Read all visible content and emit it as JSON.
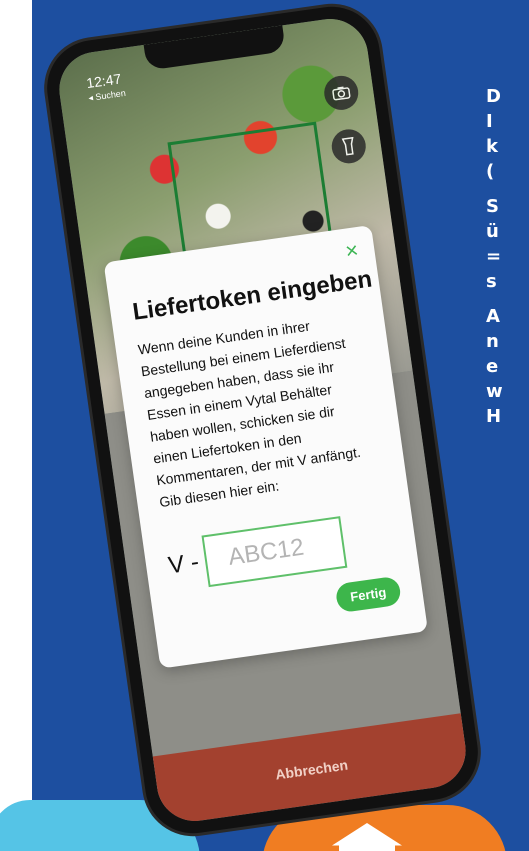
{
  "side_text": {
    "lines_block1": [
      "D",
      "I",
      "k",
      "("
    ],
    "lines_block2": [
      "S",
      "ü",
      "=",
      "s"
    ],
    "lines_block3": [
      "A",
      "n",
      "e",
      "w",
      "H"
    ]
  },
  "phone": {
    "status_time": "12:47",
    "status_back": "◂ Suchen",
    "camera_icon": "camera-icon",
    "flashlight_icon": "flashlight-icon",
    "cancel_label": "Abbrechen"
  },
  "dialog": {
    "close_glyph": "×",
    "title": "Liefertoken eingeben",
    "text": "Wenn deine Kunden in ihrer Bestellung bei einem Lieferdienst angegeben haben, dass sie ihr Essen in einem Vytal Behälter haben wollen, schicken sie dir einen Liefertoken in den Kommentaren, der mit V anfängt. Gib diesen hier ein:",
    "token_prefix": "V -",
    "token_placeholder": "ABC12",
    "token_value": "",
    "done_label": "Fertig"
  },
  "colors": {
    "panel_blue": "#1d4fa0",
    "accent_green": "#3db64b",
    "cancel_red": "#a3412f",
    "blob_cyan": "#55c4e6",
    "blob_orange": "#f07d22"
  }
}
